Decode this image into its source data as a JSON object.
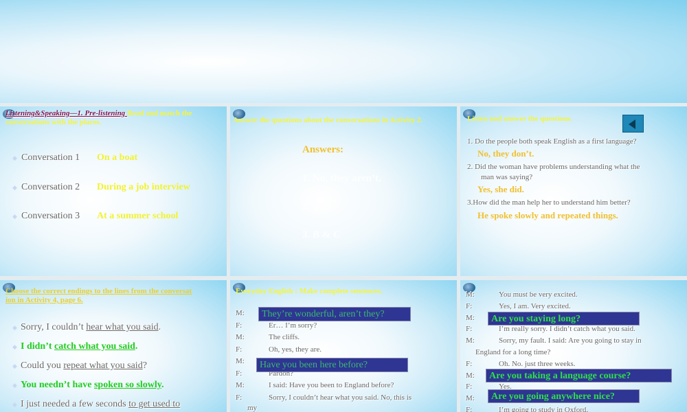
{
  "slide1": {
    "title_link": "Listening&Speaking—1. Pre-listening ",
    "title_rest": "Read and match the conversations with the places.",
    "rows": [
      {
        "label": "Conversation 1",
        "answer": "On a boat"
      },
      {
        "label": "Conversation 2",
        "answer": "During a job interview"
      },
      {
        "label": "Conversation 3",
        "answer": "At a summer school"
      }
    ]
  },
  "slide2": {
    "title": "Answer the questions about the conversations in Activity 2.",
    "heading": "Answers:",
    "answers": [
      "1. No, they aren’t.",
      "2. 1&3",
      "3.  B & C"
    ]
  },
  "slide3": {
    "title": "Listen and answer the questions.",
    "q1": "1. Do the people both speak English as a first language?",
    "a1": "No, they don’t.",
    "q2": "2. Did the woman have problems understanding what the",
    "q2b": "man was saying?",
    "a2": "Yes, she did.",
    "q3": "3.How did the man help her to understand him better?",
    "a3": "He spoke slowly and repeated things."
  },
  "slide4": {
    "title": "Choose the correct endings to the lines from the conversat",
    "title2": "ion in Activity 4, page 6.",
    "s1a": "Sorry, I couldn’t ",
    "s1u": "hear what you said",
    "s1b": ".",
    "s2a": "I didn’t ",
    "s2u": "catch what you said",
    "s2b": ".",
    "s3a": "Could you ",
    "s3u": "repeat what you said",
    "s3b": "?",
    "s4a": "You needn’t have ",
    "s4u": "spoken so slowly",
    "s4b": ".",
    "s5a": "I just needed a few seconds ",
    "s5u": "to get used to"
  },
  "slide5": {
    "title": "Everyday English :   Make complete sentences.",
    "lines": [
      {
        "sp": "M:",
        "t": ""
      },
      {
        "sp": "F:",
        "t": "Er… I’m sorry?"
      },
      {
        "sp": "M:",
        "t": "The cliffs."
      },
      {
        "sp": "F:",
        "t": "Oh, yes, they are."
      },
      {
        "sp": "M:",
        "t": ""
      },
      {
        "sp": "F:",
        "t": "Pardon?"
      },
      {
        "sp": "M:",
        "t": "I said: Have you been to England before?"
      },
      {
        "sp": "F:",
        "t": "Sorry, I couldn’t hear what you said. No, this is"
      }
    ],
    "wrap": "my",
    "box1": "They’re wonderful, aren’t they?",
    "box2": "Have you been here before?"
  },
  "slide6": {
    "lines": [
      {
        "sp": "M:",
        "t": "You must be very excited."
      },
      {
        "sp": "F:",
        "t": "Yes, I am. Very excited."
      },
      {
        "sp": "M:",
        "t": ""
      },
      {
        "sp": "F:",
        "t": "I’m really sorry. I didn’t catch what you said."
      },
      {
        "sp": "M:",
        "t": "Sorry, my fault. I said: Are you going to stay in"
      },
      {
        "sp": "",
        "t": "England for a long time?"
      },
      {
        "sp": "F:",
        "t": "Oh. No. just three weeks."
      },
      {
        "sp": "M:",
        "t": ""
      },
      {
        "sp": "F:",
        "t": "Yes."
      },
      {
        "sp": "M:",
        "t": ""
      },
      {
        "sp": "F:",
        "t": "I’m going to study in Oxford."
      }
    ],
    "box1": "Are you staying long?",
    "box2": "Are you taking a language course?",
    "box3": "Are you going anywhere nice?"
  }
}
